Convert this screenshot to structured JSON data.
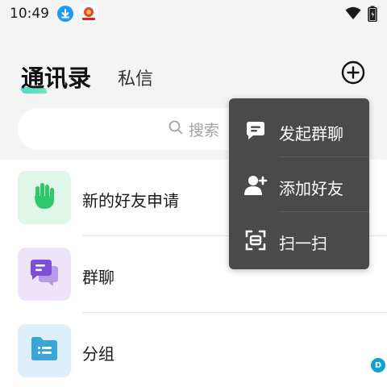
{
  "status_bar": {
    "time": "10:49",
    "icons": [
      "download-icon",
      "app-icon",
      "wifi-icon",
      "battery-icon"
    ]
  },
  "header": {
    "tabs": [
      {
        "label": "通讯录",
        "active": true
      },
      {
        "label": "私信",
        "active": false
      }
    ],
    "add_icon": "plus-circle-icon"
  },
  "search": {
    "placeholder": "搜索",
    "icon": "search-icon"
  },
  "list": {
    "items": [
      {
        "label": "新的好友申请",
        "icon": "hand-wave-icon",
        "color": "#2ec76a",
        "bg": "#dff6e8"
      },
      {
        "label": "群聊",
        "icon": "chat-bubbles-icon",
        "color": "#7b4fd6",
        "bg": "#ede4fa"
      },
      {
        "label": "分组",
        "icon": "folder-icon",
        "color": "#3aa6d8",
        "bg": "#dceffa"
      }
    ]
  },
  "popup_menu": {
    "items": [
      {
        "label": "发起群聊",
        "icon": "chat-bubble-icon"
      },
      {
        "label": "添加好友",
        "icon": "add-user-icon"
      },
      {
        "label": "扫一扫",
        "icon": "scan-icon"
      }
    ]
  },
  "corner_badge": {
    "text": "D"
  },
  "colors": {
    "accent": "#3fd7c4",
    "popup_bg": "#4a4a4a",
    "page_bg": "#f4f4f4"
  }
}
